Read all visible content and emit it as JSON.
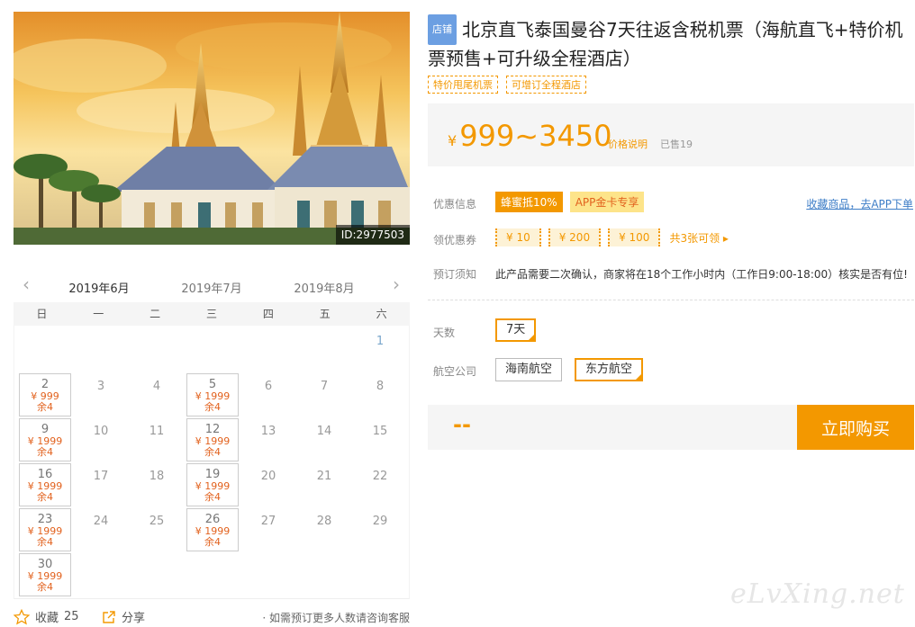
{
  "hero": {
    "image_id": "ID:2977503"
  },
  "calendar": {
    "months": [
      "2019年6月",
      "2019年7月",
      "2019年8月"
    ],
    "weekdays": [
      "日",
      "一",
      "二",
      "三",
      "四",
      "五",
      "六"
    ],
    "cells": [
      {
        "day": "1"
      },
      {
        "day": "2",
        "price": "¥ 999",
        "remain": "余4"
      },
      {
        "day": "3"
      },
      {
        "day": "4"
      },
      {
        "day": "5",
        "price": "¥ 1999",
        "remain": "余4"
      },
      {
        "day": "6"
      },
      {
        "day": "7"
      },
      {
        "day": "8"
      },
      {
        "day": "9",
        "price": "¥ 1999",
        "remain": "余4"
      },
      {
        "day": "10"
      },
      {
        "day": "11"
      },
      {
        "day": "12",
        "price": "¥ 1999",
        "remain": "余4"
      },
      {
        "day": "13"
      },
      {
        "day": "14"
      },
      {
        "day": "15"
      },
      {
        "day": "16",
        "price": "¥ 1999",
        "remain": "余4"
      },
      {
        "day": "17"
      },
      {
        "day": "18"
      },
      {
        "day": "19",
        "price": "¥ 1999",
        "remain": "余4"
      },
      {
        "day": "20"
      },
      {
        "day": "21"
      },
      {
        "day": "22"
      },
      {
        "day": "23",
        "price": "¥ 1999",
        "remain": "余4"
      },
      {
        "day": "24"
      },
      {
        "day": "25"
      },
      {
        "day": "26",
        "price": "¥ 1999",
        "remain": "余4"
      },
      {
        "day": "27"
      },
      {
        "day": "28"
      },
      {
        "day": "29"
      },
      {
        "day": "30",
        "price": "¥ 1999",
        "remain": "余4"
      }
    ]
  },
  "footer": {
    "favorite_label": "收藏",
    "favorite_count": "25",
    "share_label": "分享",
    "consult_text": "· 如需预订更多人数请咨询客服"
  },
  "product": {
    "shop_tag": "店铺",
    "title": "北京直飞泰国曼谷7天往返含税机票（海航直飞+特价机票预售+可升级全程酒店）",
    "tags": [
      "特价甩尾机票",
      "可增订全程酒店"
    ],
    "price_symbol": "¥",
    "price_range": "999~3450",
    "price_note": "价格说明",
    "sold": "已售19"
  },
  "promo": {
    "label": "优惠信息",
    "badge_a": "蜂蜜抵10%",
    "badge_b": "APP金卡专享",
    "app_link": "收藏商品，去APP下单"
  },
  "coupons": {
    "label": "领优惠券",
    "items": [
      "¥ 10",
      "¥ 200",
      "¥ 100"
    ],
    "count_text": "共3张可领 ▸"
  },
  "booking": {
    "label": "预订须知",
    "text": "此产品需要二次确认，商家将在18个工作小时内（工作日9:00-18:00）核实是否有位!"
  },
  "options": {
    "days_label": "天数",
    "days_value": "7天",
    "airline_label": "航空公司",
    "airlines": [
      "海南航空",
      "东方航空"
    ]
  },
  "buy": {
    "placeholder": "--",
    "button": "立即购买"
  },
  "watermark": "eLvXing.net",
  "colors": {
    "accent": "#f39800",
    "link": "#3d7dc7",
    "shop_tag": "#6c9fe2"
  }
}
